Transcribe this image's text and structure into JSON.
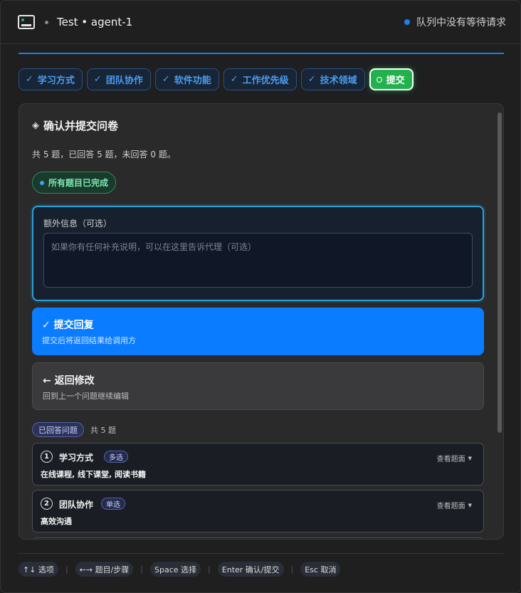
{
  "header": {
    "title": "Test • agent-1",
    "queue_status": "队列中没有等待请求"
  },
  "colors": {
    "accent_blue": "#0a7cff",
    "success_green": "#23b14d",
    "tab_text_blue": "#4a9cf0"
  },
  "progress": {
    "value": 1.0
  },
  "tabs": [
    {
      "label": "学习方式",
      "state": "done"
    },
    {
      "label": "团队协作",
      "state": "done"
    },
    {
      "label": "软件功能",
      "state": "done"
    },
    {
      "label": "工作优先级",
      "state": "done"
    },
    {
      "label": "技术领域",
      "state": "done"
    },
    {
      "label": "提交",
      "state": "active"
    }
  ],
  "panel": {
    "title": "确认并提交问卷",
    "summary": "共 5 题，已回答 5 题，未回答 0 题。",
    "complete_badge": "所有题目已完成",
    "extra": {
      "label": "额外信息（可选）",
      "placeholder": "如果你有任何补充说明，可以在这里告诉代理（可选）",
      "value": ""
    },
    "submit": {
      "title": "✓ 提交回复",
      "subtitle": "提交后将返回结果给调用方"
    },
    "back": {
      "title": "← 返回修改",
      "subtitle": "回到上一个问题继续编辑"
    },
    "answered": {
      "chip": "已回答问题",
      "count": "共 5 题"
    },
    "questions": [
      {
        "num": "1",
        "title": "学习方式",
        "type": "多选",
        "view": "查看题面",
        "answer": "在线课程, 线下课堂, 阅读书籍"
      },
      {
        "num": "2",
        "title": "团队协作",
        "type": "单选",
        "view": "查看题面",
        "answer": "高效沟通"
      }
    ]
  },
  "footer": {
    "keys": [
      "↑↓ 选项",
      "←→ 题目/步骤",
      "Space 选择",
      "Enter 确认/提交",
      "Esc 取消"
    ]
  }
}
